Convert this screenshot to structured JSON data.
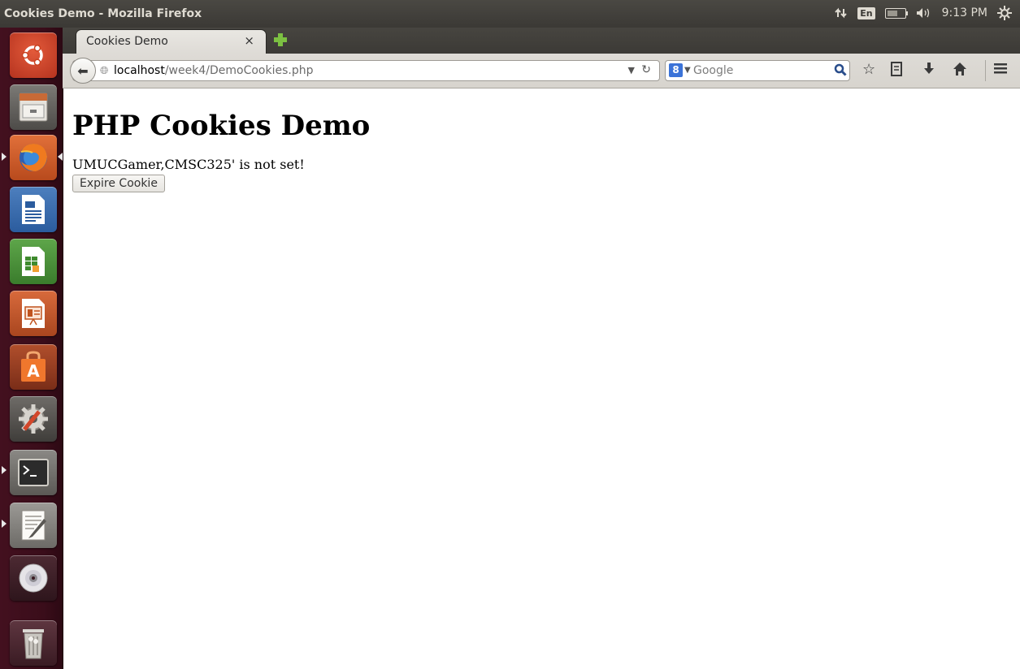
{
  "panel": {
    "window_title": "Cookies Demo - Mozilla Firefox",
    "keyboard_layout": "En",
    "clock": "9:13 PM",
    "icons": [
      "network-icon",
      "keyboard-indicator-icon",
      "battery-icon",
      "volume-icon",
      "gear-icon"
    ]
  },
  "launcher": {
    "items": [
      {
        "name": "ubuntu-dash-icon"
      },
      {
        "name": "files-icon"
      },
      {
        "name": "firefox-icon",
        "running": true,
        "focused": true
      },
      {
        "name": "libreoffice-writer-icon"
      },
      {
        "name": "libreoffice-calc-icon"
      },
      {
        "name": "libreoffice-impress-icon"
      },
      {
        "name": "software-center-icon"
      },
      {
        "name": "system-settings-icon"
      },
      {
        "name": "terminal-icon",
        "running": true
      },
      {
        "name": "text-editor-icon",
        "running": true
      },
      {
        "name": "dvd-icon"
      },
      {
        "name": "trash-icon"
      }
    ]
  },
  "browser": {
    "tab": {
      "label": "Cookies Demo"
    },
    "url": {
      "host": "localhost",
      "path": "/week4/DemoCookies.php"
    },
    "search": {
      "placeholder": "Google"
    }
  },
  "page": {
    "title": "PHP Cookies Demo",
    "status": "UMUCGamer,CMSC325' is not set!",
    "button_label": "Expire Cookie"
  },
  "colors": {
    "panel_bg": "#3c3b37",
    "launcher_bg": "#3a0d1a",
    "search_engine_blue": "#3b73d8"
  }
}
